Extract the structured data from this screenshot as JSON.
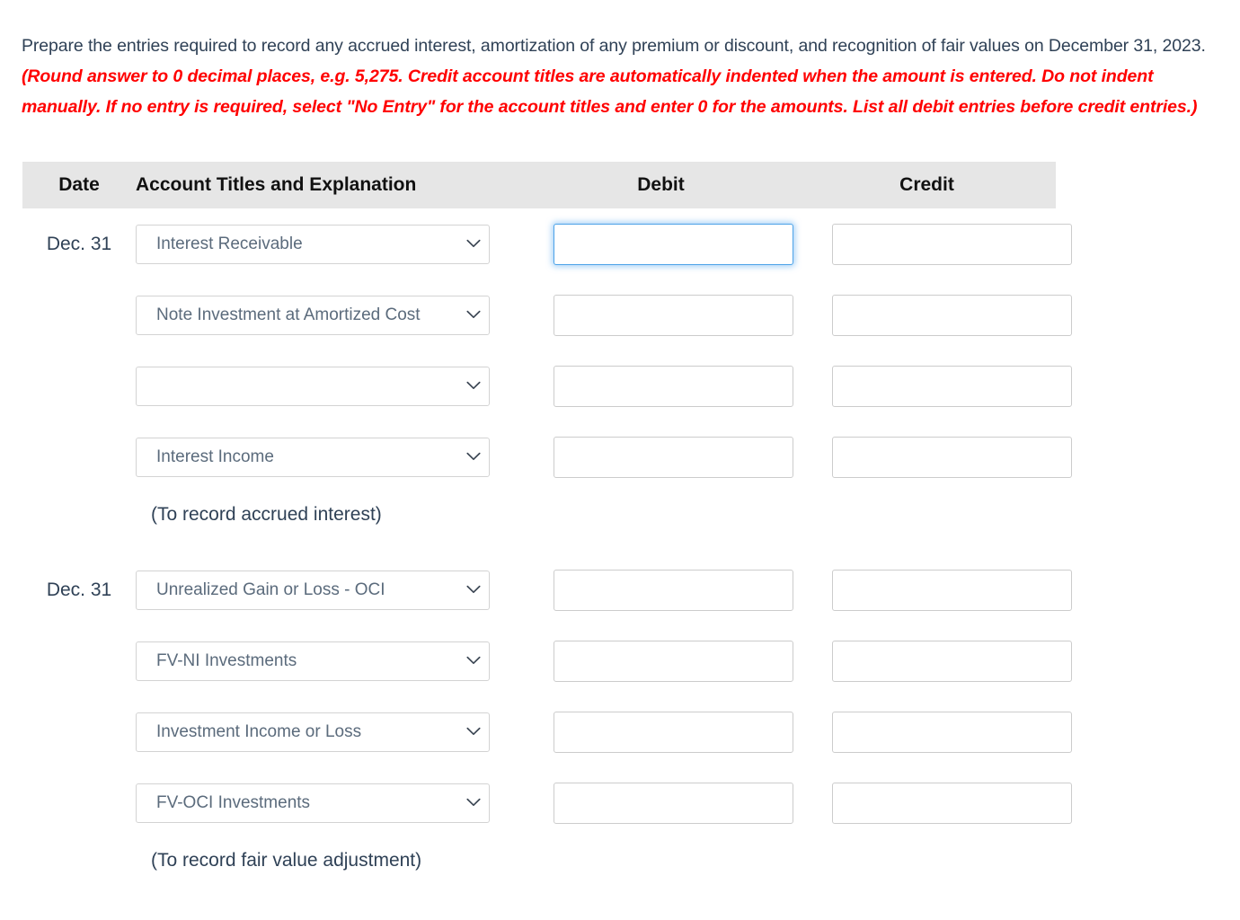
{
  "instructions": {
    "plain_text": "Prepare the entries required to record any accrued interest, amortization of any premium or discount, and recognition of fair values on December 31, 2023. ",
    "emphasis_text": "(Round answer to 0 decimal places, e.g. 5,275. Credit account titles are automatically indented when the amount is entered. Do not indent manually. If no entry is required, select \"No Entry\" for the account titles and enter 0 for the amounts. List all debit entries before credit entries.)",
    "emphasis_color": "#ff0000"
  },
  "journal": {
    "headers": {
      "date": "Date",
      "account": "Account Titles and Explanation",
      "debit": "Debit",
      "credit": "Credit"
    },
    "header_background": "#e6e6e6",
    "focus_color": "#4da3e8",
    "entries": [
      {
        "rows": [
          {
            "date": "Dec. 31",
            "account": "Interest Receivable",
            "debit": "",
            "credit": "",
            "debit_focused": true
          },
          {
            "date": "",
            "account": "Note Investment at Amortized Cost",
            "debit": "",
            "credit": "",
            "debit_focused": false
          },
          {
            "date": "",
            "account": "",
            "debit": "",
            "credit": "",
            "debit_focused": false
          },
          {
            "date": "",
            "account": "Interest Income",
            "debit": "",
            "credit": "",
            "debit_focused": false
          }
        ],
        "memo": "(To record accrued interest)"
      },
      {
        "rows": [
          {
            "date": "Dec. 31",
            "account": "Unrealized Gain or Loss - OCI",
            "debit": "",
            "credit": "",
            "debit_focused": false
          },
          {
            "date": "",
            "account": "FV-NI Investments",
            "debit": "",
            "credit": "",
            "debit_focused": false
          },
          {
            "date": "",
            "account": "Investment Income or Loss",
            "debit": "",
            "credit": "",
            "debit_focused": false
          },
          {
            "date": "",
            "account": "FV-OCI Investments",
            "debit": "",
            "credit": "",
            "debit_focused": false
          }
        ],
        "memo": "(To record fair value adjustment)"
      }
    ]
  }
}
